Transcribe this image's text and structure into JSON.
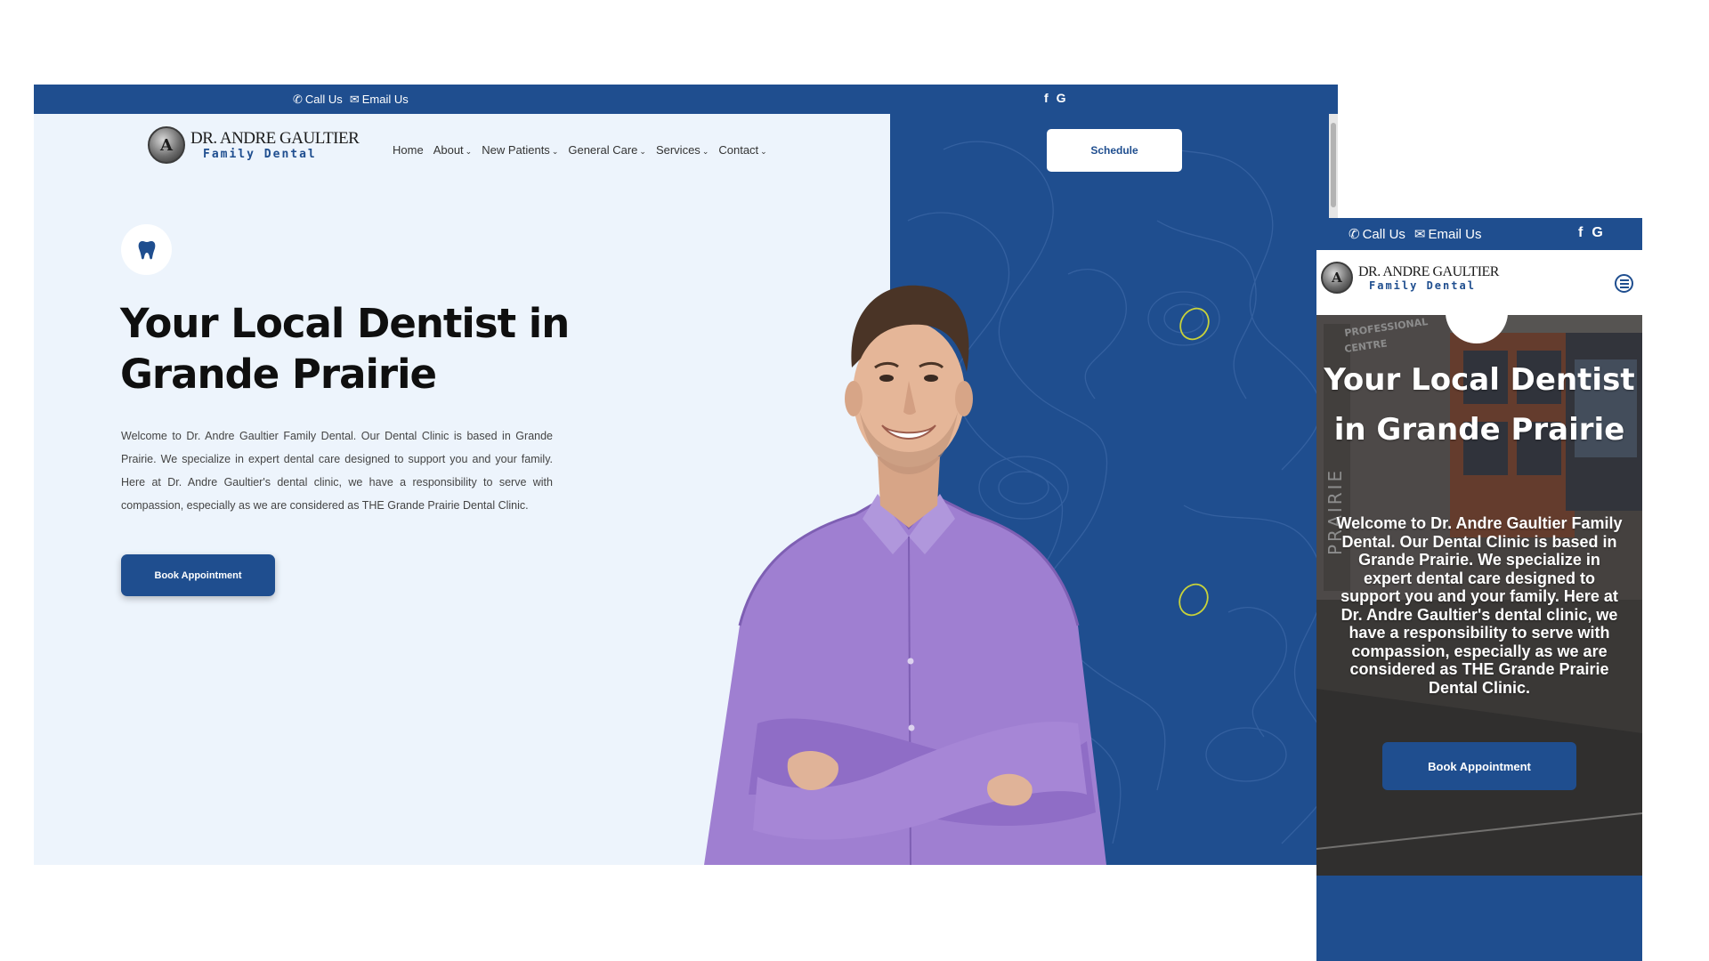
{
  "desktop": {
    "topbar": {
      "call": "Call Us",
      "email": "Email Us",
      "facebook": "f",
      "google": "G"
    },
    "logo": {
      "initials": "A",
      "line1": "DR. ANDRE GAULTIER",
      "line2": "Family Dental"
    },
    "nav": [
      {
        "label": "Home",
        "dropdown": false
      },
      {
        "label": "About",
        "dropdown": true
      },
      {
        "label": "New Patients",
        "dropdown": true
      },
      {
        "label": "General Care",
        "dropdown": true
      },
      {
        "label": "Services",
        "dropdown": true
      },
      {
        "label": "Contact",
        "dropdown": true
      }
    ],
    "chevron": "⌄",
    "schedule_label": "Schedule",
    "hero": {
      "icon": "tooth-icon",
      "title": "Your Local Dentist in Grande Prairie",
      "paragraph": "Welcome to Dr. Andre Gaultier Family Dental. Our Dental Clinic is based in Grande Prairie. We specialize in expert dental care designed to support you and your family. Here at Dr. Andre Gaultier's dental clinic, we have a responsibility to serve with compassion, especially as we are considered as THE Grande Prairie Dental Clinic.",
      "button_label": "Book Appointment"
    }
  },
  "mobile": {
    "topbar": {
      "call": "Call Us",
      "email": "Email Us",
      "facebook": "f",
      "google": "G"
    },
    "logo": {
      "initials": "A",
      "line1": "DR. ANDRE GAULTIER",
      "line2": "Family Dental"
    },
    "menu_icon": "hamburger-menu-icon",
    "hero": {
      "sign_text": "PROFESSIONAL CENTRE",
      "sign_vertical": "PRAIRIE",
      "title": "Your Local Dentist in Grande Prairie",
      "paragraph": "Welcome to Dr. Andre Gaultier Family Dental. Our Dental Clinic is based in Grande Prairie. We specialize in expert dental care designed to support you and your family. Here at Dr. Andre Gaultier's dental clinic, we have a responsibility to serve with compassion, especially as we are considered as THE Grande Prairie Dental Clinic.",
      "button_label": "Book Appointment"
    }
  },
  "colors": {
    "brand_blue": "#1f4e8f",
    "hero_bg": "#edf4fc",
    "shirt_purple": "#9f7fd1",
    "accent_yellow": "#c8d23a"
  }
}
